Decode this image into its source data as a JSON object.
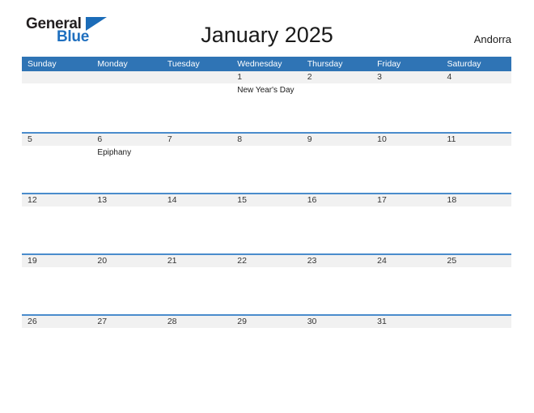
{
  "brand": {
    "name_part1": "General",
    "name_part2": "Blue",
    "triangle_color": "#1b6cb8",
    "text_color": "#231f20",
    "accent_color": "#1f6fbf"
  },
  "header": {
    "title": "January 2025",
    "country": "Andorra"
  },
  "theme": {
    "header_blue": "#2f74b5",
    "row_divider_blue": "#4a8ccc",
    "band_gray": "#f1f1f1",
    "text_dark": "#333333"
  },
  "calendar": {
    "weekdays": [
      "Sunday",
      "Monday",
      "Tuesday",
      "Wednesday",
      "Thursday",
      "Friday",
      "Saturday"
    ],
    "weeks": [
      {
        "days": [
          {
            "num": "",
            "events": []
          },
          {
            "num": "",
            "events": []
          },
          {
            "num": "",
            "events": []
          },
          {
            "num": "1",
            "events": [
              "New Year's Day"
            ]
          },
          {
            "num": "2",
            "events": []
          },
          {
            "num": "3",
            "events": []
          },
          {
            "num": "4",
            "events": []
          }
        ]
      },
      {
        "days": [
          {
            "num": "5",
            "events": []
          },
          {
            "num": "6",
            "events": [
              "Epiphany"
            ]
          },
          {
            "num": "7",
            "events": []
          },
          {
            "num": "8",
            "events": []
          },
          {
            "num": "9",
            "events": []
          },
          {
            "num": "10",
            "events": []
          },
          {
            "num": "11",
            "events": []
          }
        ]
      },
      {
        "days": [
          {
            "num": "12",
            "events": []
          },
          {
            "num": "13",
            "events": []
          },
          {
            "num": "14",
            "events": []
          },
          {
            "num": "15",
            "events": []
          },
          {
            "num": "16",
            "events": []
          },
          {
            "num": "17",
            "events": []
          },
          {
            "num": "18",
            "events": []
          }
        ]
      },
      {
        "days": [
          {
            "num": "19",
            "events": []
          },
          {
            "num": "20",
            "events": []
          },
          {
            "num": "21",
            "events": []
          },
          {
            "num": "22",
            "events": []
          },
          {
            "num": "23",
            "events": []
          },
          {
            "num": "24",
            "events": []
          },
          {
            "num": "25",
            "events": []
          }
        ]
      },
      {
        "days": [
          {
            "num": "26",
            "events": []
          },
          {
            "num": "27",
            "events": []
          },
          {
            "num": "28",
            "events": []
          },
          {
            "num": "29",
            "events": []
          },
          {
            "num": "30",
            "events": []
          },
          {
            "num": "31",
            "events": []
          },
          {
            "num": "",
            "events": []
          }
        ]
      }
    ]
  }
}
